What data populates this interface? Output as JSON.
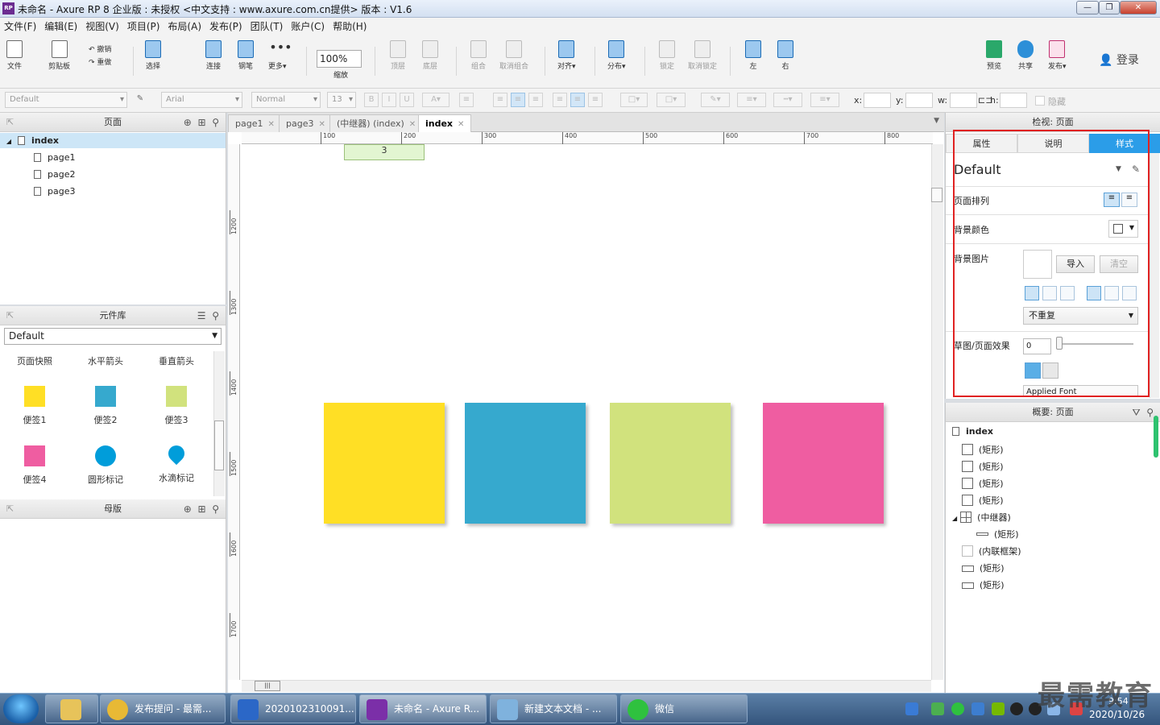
{
  "window": {
    "title": "未命名 - Axure RP 8 企业版 : 未授权     <中文支持 : www.axure.com.cn提供> 版本 : V1.6",
    "app_badge": "RP"
  },
  "menu": [
    "文件(F)",
    "编辑(E)",
    "视图(V)",
    "项目(P)",
    "布局(A)",
    "发布(P)",
    "团队(T)",
    "账户(C)",
    "帮助(H)"
  ],
  "toolbar": {
    "file": "文件",
    "clipboard": "剪贴板",
    "undo": "撤销",
    "redo": "重做",
    "select": "选择",
    "connect": "连接",
    "pen": "钢笔",
    "more": "更多▾",
    "zoom_value": "100%",
    "zoom_label": "缩放",
    "top": "顶层",
    "bottom": "底层",
    "group": "组合",
    "ungroup": "取消组合",
    "align": "对齐▾",
    "distribute": "分布▾",
    "lock": "锁定",
    "unlock": "取消锁定",
    "left": "左",
    "right": "右",
    "preview": "预览",
    "share": "共享",
    "publish": "发布▾",
    "login": "登录"
  },
  "format": {
    "style": "Default",
    "font": "Arial",
    "weight": "Normal",
    "size": "13",
    "x_label": "x:",
    "y_label": "y:",
    "w_label": "w:",
    "h_label": "h:",
    "hide_label": "隐藏"
  },
  "pages_panel": {
    "title": "页面",
    "items": [
      "index",
      "page1",
      "page2",
      "page3"
    ]
  },
  "library_panel": {
    "title": "元件库",
    "selected": "Default",
    "widgets": [
      {
        "label": "页面快照"
      },
      {
        "label": "水平箭头"
      },
      {
        "label": "垂直箭头"
      },
      {
        "label": "便签1",
        "color": "#ffdf25"
      },
      {
        "label": "便签2",
        "color": "#36a9ce"
      },
      {
        "label": "便签3",
        "color": "#d1e27d"
      },
      {
        "label": "便签4",
        "color": "#ef5da1"
      },
      {
        "label": "圆形标记",
        "color": "#009dda"
      },
      {
        "label": "水滴标记",
        "color": "#009dda"
      }
    ]
  },
  "masters_panel": {
    "title": "母版"
  },
  "tabs": [
    {
      "label": "page1",
      "active": false
    },
    {
      "label": "page3",
      "active": false
    },
    {
      "label": "(中继器) (index)",
      "active": false
    },
    {
      "label": "index",
      "active": true
    }
  ],
  "ruler": {
    "x": [
      "100",
      "200",
      "300",
      "400",
      "500",
      "600",
      "700",
      "800"
    ],
    "y": [
      "1200",
      "1300",
      "1400",
      "1500",
      "1600",
      "1700"
    ]
  },
  "canvas": {
    "repeater_value": "3",
    "notes": [
      {
        "color": "#ffdf25"
      },
      {
        "color": "#36a9ce"
      },
      {
        "color": "#d1e27d"
      },
      {
        "color": "#ef5da1"
      }
    ]
  },
  "inspector": {
    "header": "检视: 页面",
    "tabs": [
      "属性",
      "说明",
      "样式"
    ],
    "active_tab": "样式",
    "style_name": "Default",
    "page_align": "页面排列",
    "bg_color": "背景颜色",
    "bg_image": "背景图片",
    "import": "导入",
    "clear": "清空",
    "repeat": "不重复",
    "sketch": "草图/页面效果",
    "sketch_value": "0",
    "applied_font": "Applied Font"
  },
  "outline": {
    "title": "概要: 页面",
    "root": "index",
    "items": [
      "(矩形)",
      "(矩形)",
      "(矩形)",
      "(矩形)",
      "(中继器)",
      "(矩形)",
      "(内联框架)",
      "(矩形)",
      "(矩形)"
    ]
  },
  "taskbar": {
    "tasks": [
      {
        "label": "发布提问 - 最需...",
        "color": "#e8b935"
      },
      {
        "label": "2020102310091...",
        "color": "#2b67c7"
      },
      {
        "label": "未命名 - Axure R...",
        "color": "#7b2fa8"
      },
      {
        "label": "新建文本文档 - ...",
        "color": "#7fb2dd"
      },
      {
        "label": "微信",
        "color": "#2fc13f"
      }
    ],
    "time": "9:54",
    "date": "2020/10/26",
    "watermark": "最需教育"
  }
}
